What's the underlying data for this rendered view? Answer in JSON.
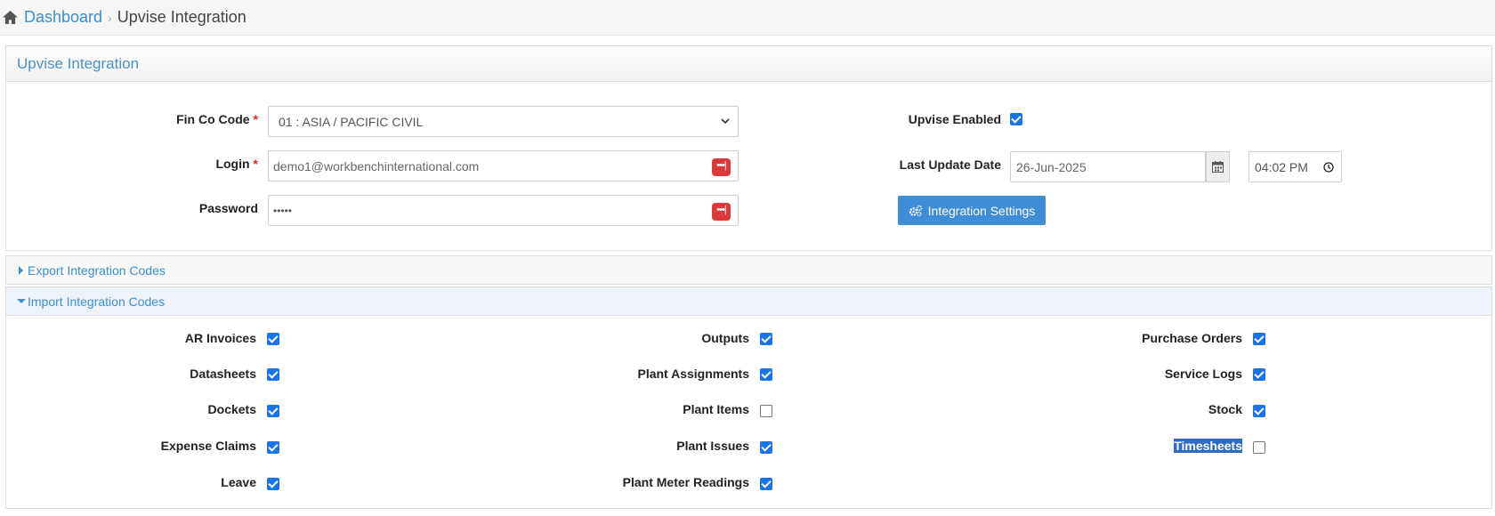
{
  "breadcrumb": {
    "home": "Dashboard",
    "current": "Upvise Integration"
  },
  "panel": {
    "title": "Upvise Integration",
    "fin_co_code": {
      "label": "Fin Co Code",
      "value": "01 : ASIA / PACIFIC CIVIL"
    },
    "login": {
      "label": "Login",
      "value": "demo1@workbenchinternational.com"
    },
    "password": {
      "label": "Password",
      "value": "•••••"
    },
    "upvise_enabled": {
      "label": "Upvise Enabled",
      "checked": true
    },
    "last_update": {
      "label": "Last Update Date",
      "date": "26-Jun-2025",
      "time": "04:02 PM"
    },
    "integration_settings_button": "Integration Settings",
    "required_mark": "*",
    "password_manager_glyph": "•••|"
  },
  "export_section": {
    "title": "Export Integration Codes",
    "expanded": false
  },
  "import_section": {
    "title": "Import Integration Codes",
    "expanded": true,
    "columns": [
      [
        {
          "label": "AR Invoices",
          "checked": true
        },
        {
          "label": "Datasheets",
          "checked": true
        },
        {
          "label": "Dockets",
          "checked": true
        },
        {
          "label": "Expense Claims",
          "checked": true
        },
        {
          "label": "Leave",
          "checked": true
        }
      ],
      [
        {
          "label": "Outputs",
          "checked": true
        },
        {
          "label": "Plant Assignments",
          "checked": true
        },
        {
          "label": "Plant Items",
          "checked": false
        },
        {
          "label": "Plant Issues",
          "checked": true
        },
        {
          "label": "Plant Meter Readings",
          "checked": true
        }
      ],
      [
        {
          "label": "Purchase Orders",
          "checked": true
        },
        {
          "label": "Service Logs",
          "checked": true
        },
        {
          "label": "Stock",
          "checked": true
        },
        {
          "label": "Timesheets",
          "checked": false,
          "selected_text": true
        }
      ]
    ]
  },
  "colors": {
    "accent": "#3a8fd0",
    "checkbox": "#1a73e8",
    "danger": "#dc3a3a",
    "button": "#3d8ed6"
  }
}
